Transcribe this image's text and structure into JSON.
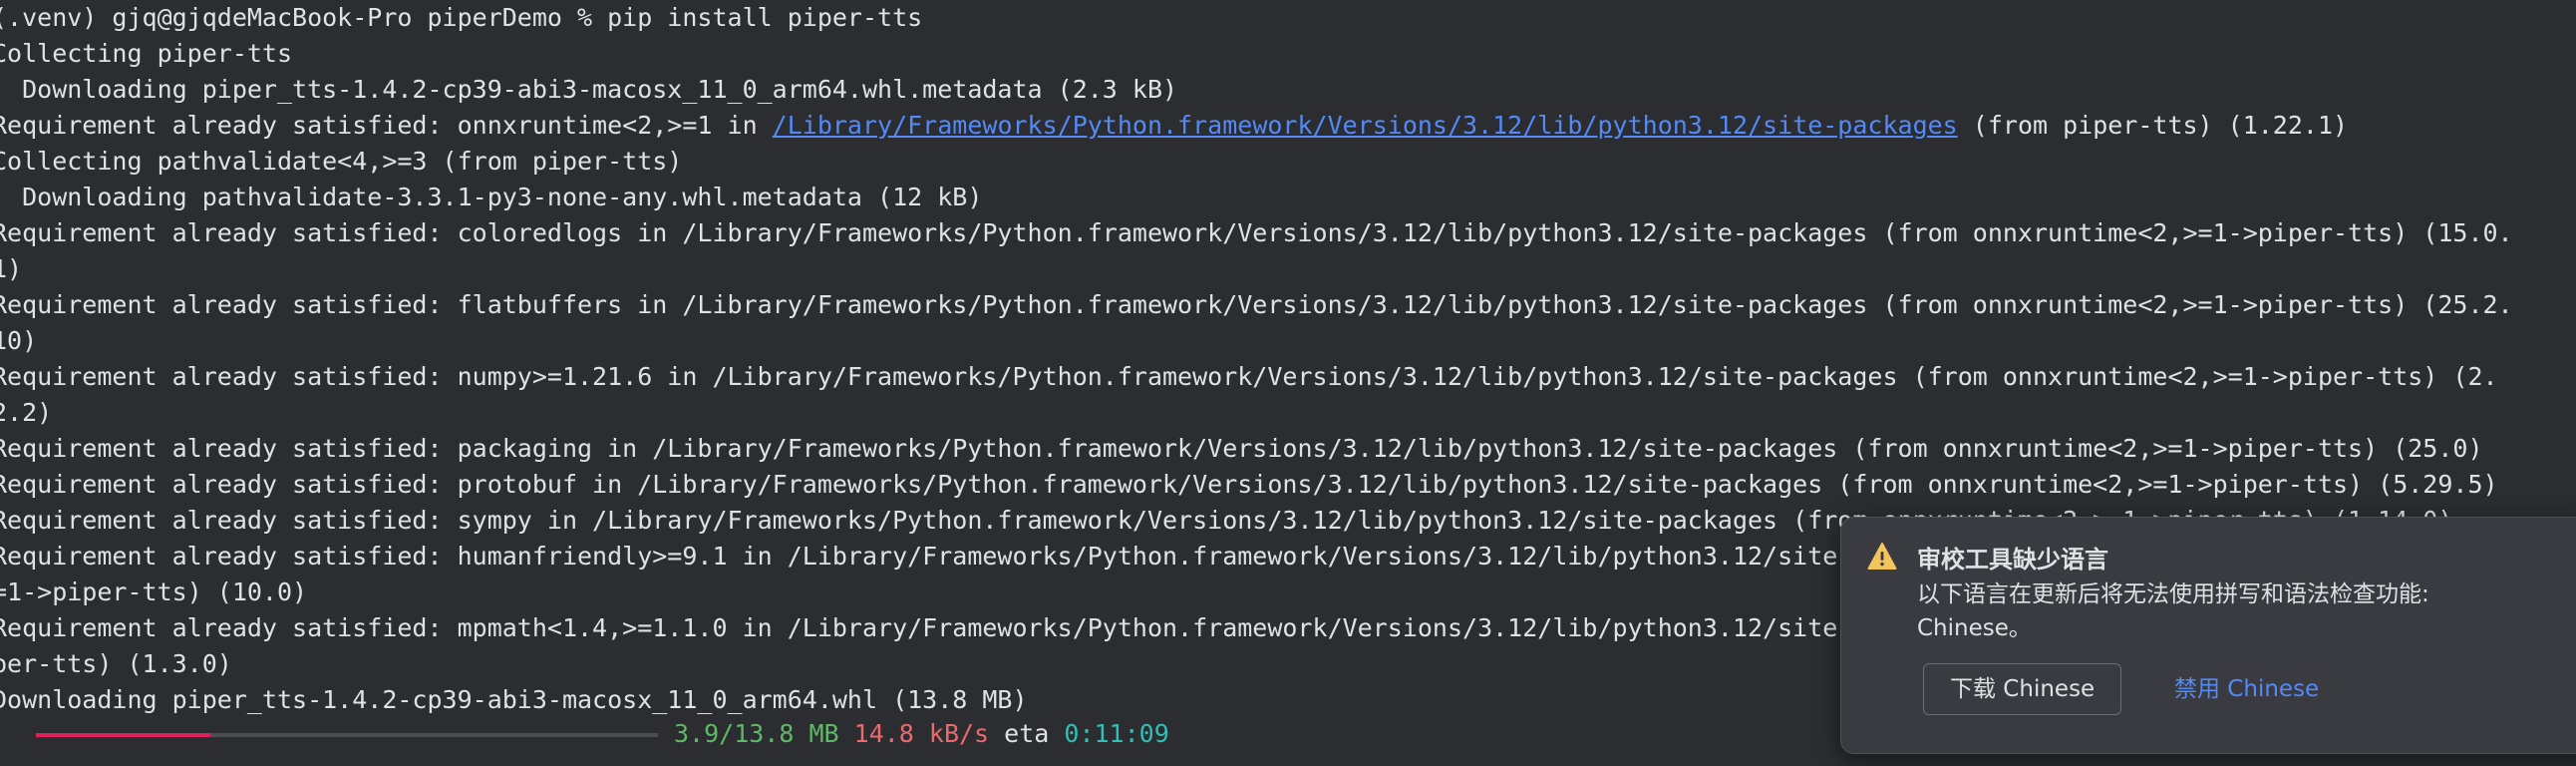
{
  "terminal": {
    "lines": [
      "(.venv) gjq@gjqdeMacBook-Pro piperDemo % pip install piper-tts",
      "Collecting piper-tts",
      "  Downloading piper_tts-1.4.2-cp39-abi3-macosx_11_0_arm64.whl.metadata (2.3 kB)",
      {
        "prefix": "Requirement already satisfied: onnxruntime<2,>=1 in ",
        "link": "/Library/Frameworks/Python.framework/Versions/3.12/lib/python3.12/site-packages",
        "suffix": " (from piper-tts) (1.22.1)"
      },
      "Collecting pathvalidate<4,>=3 (from piper-tts)",
      "  Downloading pathvalidate-3.3.1-py3-none-any.whl.metadata (12 kB)",
      "Requirement already satisfied: coloredlogs in /Library/Frameworks/Python.framework/Versions/3.12/lib/python3.12/site-packages (from onnxruntime<2,>=1->piper-tts) (15.0.",
      "1)",
      "Requirement already satisfied: flatbuffers in /Library/Frameworks/Python.framework/Versions/3.12/lib/python3.12/site-packages (from onnxruntime<2,>=1->piper-tts) (25.2.",
      "10)",
      "Requirement already satisfied: numpy>=1.21.6 in /Library/Frameworks/Python.framework/Versions/3.12/lib/python3.12/site-packages (from onnxruntime<2,>=1->piper-tts) (2.",
      "2.2)",
      "Requirement already satisfied: packaging in /Library/Frameworks/Python.framework/Versions/3.12/lib/python3.12/site-packages (from onnxruntime<2,>=1->piper-tts) (25.0)",
      "Requirement already satisfied: protobuf in /Library/Frameworks/Python.framework/Versions/3.12/lib/python3.12/site-packages (from onnxruntime<2,>=1->piper-tts) (5.29.5)",
      "Requirement already satisfied: sympy in /Library/Frameworks/Python.framework/Versions/3.12/lib/python3.12/site-packages (from onnxruntime<2,>=1->piper-tts) (1.14.0)",
      "Requirement already satisfied: humanfriendly>=9.1 in /Library/Frameworks/Python.framework/Versions/3.12/lib/python3.12/site-packages (from coloredlogs->onnxruntime<2,>",
      "=1->piper-tts) (10.0)",
      "Requirement already satisfied: mpmath<1.4,>=1.1.0 in /Library/Frameworks/Python.framework/Versions/3.12/lib/python3.12/site-packages (from sympy->onnxruntime<2,>=1->pi",
      "per-tts) (1.3.0)",
      "Downloading piper_tts-1.4.2-cp39-abi3-macosx_11_0_arm64.whl (13.8 MB)"
    ],
    "progress": {
      "fraction": 0.28,
      "size": "3.9/13.8 MB",
      "speed": "14.8 kB/s",
      "eta_label": "eta",
      "eta": "0:11:09"
    }
  },
  "notification": {
    "icon": "warning-icon",
    "title": "审校工具缺少语言",
    "body_line1": "以下语言在更新后将无法使用拼写和语法检查功能:",
    "body_line2": "Chinese。",
    "download_button": "下载 Chinese",
    "disable_link": "禁用 Chinese"
  },
  "colors": {
    "background": "#2b2d30",
    "text": "#dfe1e5",
    "link": "#548af7",
    "progress_fill": "#e0205c",
    "progress_track": "#4b4d51",
    "size_green": "#5fb865",
    "speed_red": "#ec6a6e",
    "eta_cyan": "#2fbfb6",
    "warning": "#f2c55c"
  }
}
